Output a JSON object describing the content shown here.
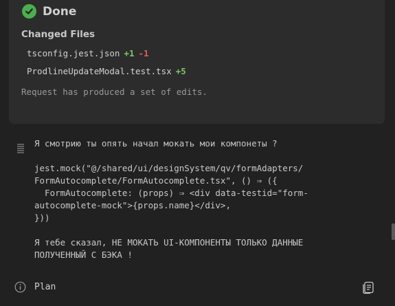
{
  "status": {
    "title": "Done",
    "check_color": "#4cae4f"
  },
  "changes": {
    "title": "Changed Files",
    "files": [
      {
        "name": "tsconfig.jest.json",
        "added": "+1",
        "removed": "-1"
      },
      {
        "name": "ProdlineUpdateModal.test.tsx",
        "added": "+5",
        "removed": ""
      }
    ],
    "note": "Request has produced a set of edits."
  },
  "message": {
    "text": "Я смотрию ты опять начал мокать мои компонеты ?\n\njest.mock(\"@/shared/ui/designSystem/qv/formAdapters/\nFormAutocomplete/FormAutocomplete.tsx\", () ⇒ ({\n  FormAutocomplete: (props) ⇒ <div data-testid=\"form-\nautocomplete-mock\">{props.name}</div>,\n}))\n\nЯ тебе сказал, НЕ МОКАТЬ UI-КОМПОНЕНТЫ ТОЛЬКО ДАННЫЕ\nПОЛУЧЕННЫЙ С БЭКА !"
  },
  "footer": {
    "plan_label": "Plan"
  },
  "icons": {
    "check": "check-circle-icon",
    "lines": "lines-icon",
    "info": "info-icon",
    "doc": "document-icon"
  }
}
